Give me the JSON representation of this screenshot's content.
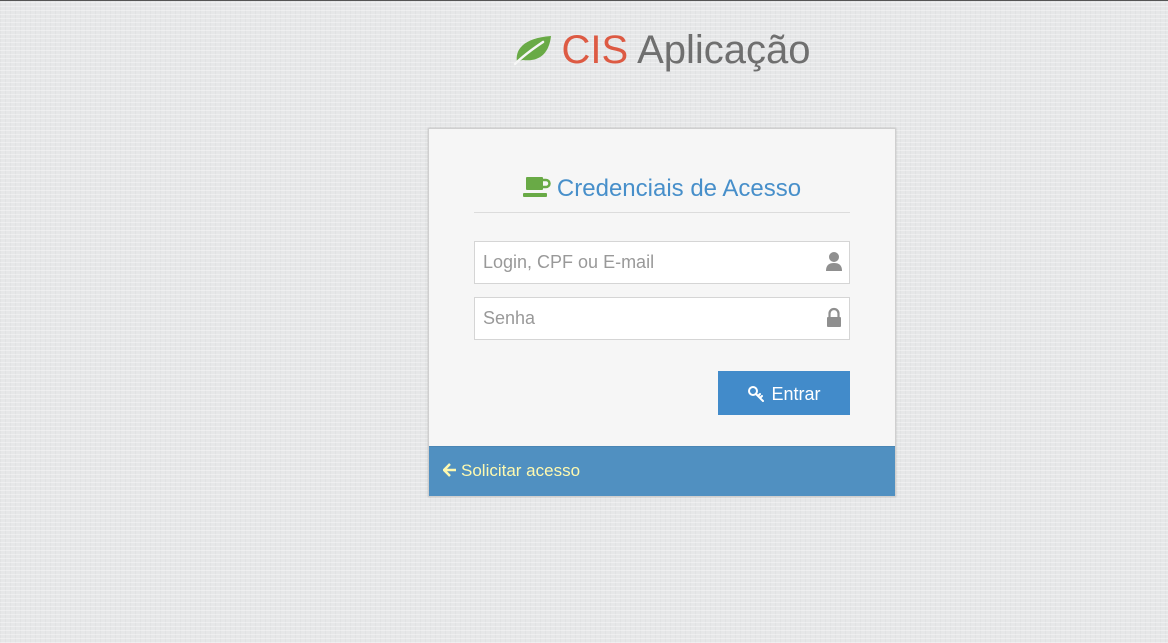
{
  "brand": {
    "name": "CIS",
    "subtitle": "Aplicação",
    "icon": "leaf-icon",
    "name_color": "#dd5a43",
    "subtitle_color": "#6f6f6f",
    "icon_color": "#69aa46"
  },
  "login": {
    "header": "Credenciais de Acesso",
    "header_icon": "coffee-icon",
    "header_color": "#478fca",
    "username": {
      "placeholder": "Login, CPF ou E-mail",
      "value": "",
      "icon": "user-icon"
    },
    "password": {
      "placeholder": "Senha",
      "value": "",
      "icon": "lock-icon"
    },
    "submit_label": "Entrar",
    "submit_icon": "key-icon",
    "submit_color": "#428bca"
  },
  "toolbar": {
    "request_access_label": "Solicitar acesso",
    "request_access_icon": "arrow-left-icon",
    "background": "#5090c1",
    "link_color": "#fef9b0"
  }
}
